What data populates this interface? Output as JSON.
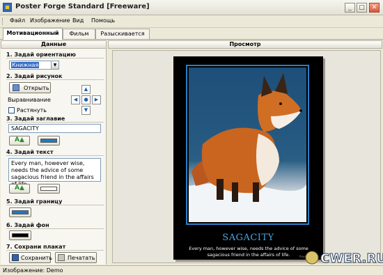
{
  "window": {
    "title": "Poster Forge Standard [Freeware]",
    "buttons": {
      "minimize": "_",
      "maximize": "□",
      "close": "✕"
    }
  },
  "menu": [
    "Файл",
    "Изображение",
    "Вид",
    "Помощь"
  ],
  "tabs": [
    "Мотивационный",
    "Фильм",
    "Разыскивается"
  ],
  "left_panel": {
    "header": "Данные",
    "sections": {
      "orientation": {
        "title": "1. Задай ориентацию",
        "value": "Книжная"
      },
      "picture": {
        "title": "2. Задай рисунок",
        "open_button": "Открыть",
        "align_label": "Выравнивание",
        "stretch_label": "Растянуть"
      },
      "heading": {
        "title": "3. Задай заглавие",
        "value": "SAGACITY",
        "color": "#1E7BC0"
      },
      "text": {
        "title": "4. Задай текст",
        "value": "Every man, however wise, needs the advice of some sagacious friend in the affairs of life.",
        "color": "#FFFFFF"
      },
      "border": {
        "title": "5. Задай границу",
        "color": "#1E7BC0"
      },
      "background": {
        "title": "6. Задай фон",
        "color": "#000000"
      },
      "save": {
        "title": "7. Сохрани плакат",
        "save_button": "Сохранить",
        "print_button": "Печатать"
      }
    }
  },
  "right_panel": {
    "header": "Просмотр",
    "poster": {
      "title": "SAGACITY",
      "text": "Every man, however wise, needs the advice of some sagacious friend in the affairs of life.",
      "powered": "Powered by ..."
    }
  },
  "status": "Изображение: Demo",
  "watermark": "CWER.RU",
  "colors": {
    "accent": "#2A7FC7",
    "frame": "#ECE9D8"
  },
  "icons": {
    "app": "app-icon",
    "open": "folder-icon",
    "save": "floppy-icon",
    "print": "printer-icon",
    "font": "font-icon",
    "align": [
      "align-top-icon",
      "align-left-icon",
      "align-center-icon",
      "align-right-icon",
      "align-bottom-icon"
    ]
  }
}
